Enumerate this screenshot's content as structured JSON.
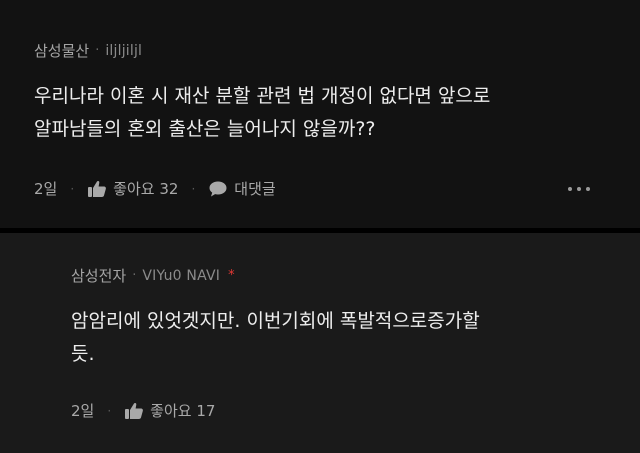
{
  "post": {
    "company": "삼성물산",
    "separator": "·",
    "handle": "iljljiljl",
    "lines": [
      "우리나라 이혼 시 재산 분할 관련 법 개정이 없다면 앞으로",
      "알파남들의 혼외 출산은 늘어나지 않을까??"
    ],
    "time": "2일",
    "like_label": "좋아요 32",
    "comment_label": "대댓글",
    "icons": [
      "thumbs-up-icon",
      "comment-icon",
      "more-icon"
    ]
  },
  "reply": {
    "company": "삼성전자",
    "separator": "·",
    "handle": "VIYu0 NAVI",
    "badge": "*",
    "lines": [
      "암암리에 있엇겟지만. 이번기회에 폭발적으로증가할",
      "듯."
    ],
    "time": "2일",
    "like_label": "좋아요 17",
    "icons": [
      "thumbs-up-icon"
    ]
  },
  "colors": {
    "background": "#121212",
    "reply_background": "#1a1a1a",
    "text": "#ededed",
    "muted": "#a4a4a4",
    "badge": "#e53935"
  }
}
